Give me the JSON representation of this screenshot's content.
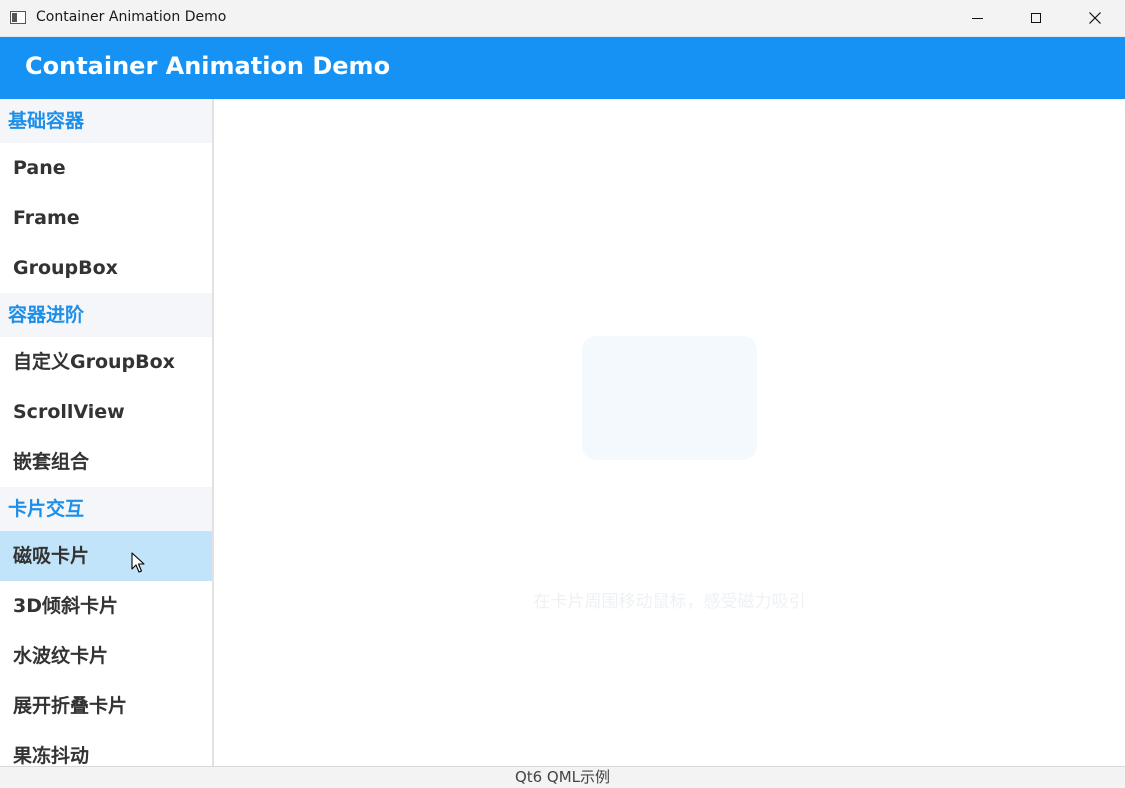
{
  "window": {
    "title": "Container Animation Demo",
    "controls": [
      "minimize-icon",
      "maximize-icon",
      "close-icon"
    ]
  },
  "header": {
    "title": "Container Animation Demo",
    "background": "#1592f4"
  },
  "sidebar": {
    "sections": [
      {
        "title": "基础容器",
        "items": [
          "Pane",
          "Frame",
          "GroupBox"
        ]
      },
      {
        "title": "容器进阶",
        "items": [
          "自定义GroupBox",
          "ScrollView",
          "嵌套组合"
        ]
      },
      {
        "title": "卡片交互",
        "items": [
          "磁吸卡片",
          "3D倾斜卡片",
          "水波纹卡片",
          "展开折叠卡片",
          "果冻抖动"
        ]
      }
    ],
    "selected_item": "磁吸卡片",
    "accent_color": "#1e8fe8",
    "selected_color": "#c1e4fb"
  },
  "main": {
    "hint": "在卡片周围移动鼠标，感受磁力吸引"
  },
  "status_bar": {
    "text": "Qt6 QML示例"
  }
}
